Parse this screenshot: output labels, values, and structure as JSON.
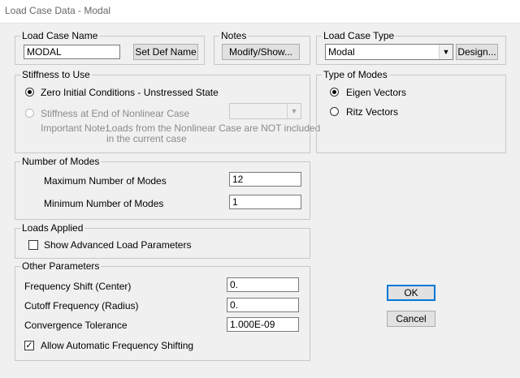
{
  "window": {
    "title": "Load Case Data - Modal"
  },
  "load_case_name": {
    "legend": "Load Case Name",
    "value": "MODAL",
    "set_def_name_label": "Set Def Name"
  },
  "notes": {
    "legend": "Notes",
    "modify_show_label": "Modify/Show..."
  },
  "load_case_type": {
    "legend": "Load Case Type",
    "selected": "Modal",
    "design_label": "Design..."
  },
  "stiffness": {
    "legend": "Stiffness to Use",
    "option_zero": "Zero Initial Conditions - Unstressed State",
    "option_nonlinear": "Stiffness at End of Nonlinear Case",
    "note_label": "Important Note:",
    "note_line1": "Loads from the Nonlinear Case are NOT included",
    "note_line2": "in the current case",
    "selected": "zero"
  },
  "type_of_modes": {
    "legend": "Type of Modes",
    "option_eigen": "Eigen Vectors",
    "option_ritz": "Ritz Vectors",
    "selected": "eigen"
  },
  "number_of_modes": {
    "legend": "Number of Modes",
    "max_label": "Maximum Number of Modes",
    "max_value": "12",
    "min_label": "Minimum Number of Modes",
    "min_value": "1"
  },
  "loads_applied": {
    "legend": "Loads Applied",
    "show_advanced_label": "Show Advanced Load Parameters",
    "show_advanced_checked": false
  },
  "other_parameters": {
    "legend": "Other Parameters",
    "freq_shift_label": "Frequency Shift (Center)",
    "freq_shift_value": "0.",
    "cutoff_label": "Cutoff Frequency (Radius)",
    "cutoff_value": "0.",
    "tolerance_label": "Convergence Tolerance",
    "tolerance_value": "1.000E-09",
    "auto_shift_label": "Allow Automatic Frequency Shifting",
    "auto_shift_checked": true
  },
  "buttons": {
    "ok_label": "OK",
    "cancel_label": "Cancel"
  }
}
